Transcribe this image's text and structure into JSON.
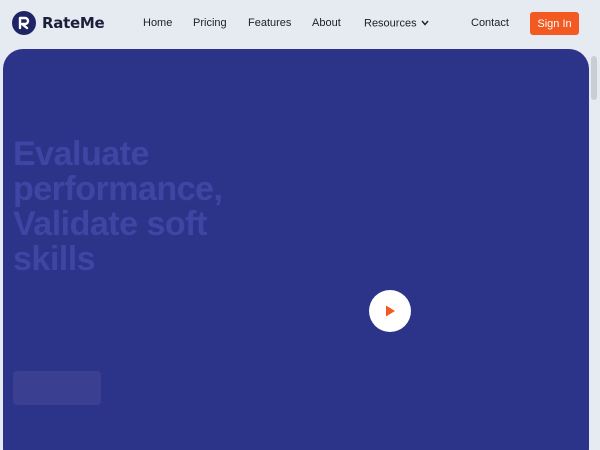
{
  "brand": {
    "name": "RateMe",
    "logo_letter": "R"
  },
  "nav": {
    "home": "Home",
    "pricing": "Pricing",
    "features": "Features",
    "about": "About",
    "resources": "Resources",
    "contact": "Contact",
    "signin": "Sign In"
  },
  "hero": {
    "headline": "Evaluate performance, Validate soft skills",
    "subtext": "",
    "cta_label": ""
  },
  "colors": {
    "brand_navy": "#1f2466",
    "hero_bg": "#2b3488",
    "accent_orange": "#f25a22"
  },
  "icons": {
    "play": "play-icon",
    "chevron": "chevron-down-icon",
    "logo": "rateme-logo-icon"
  }
}
